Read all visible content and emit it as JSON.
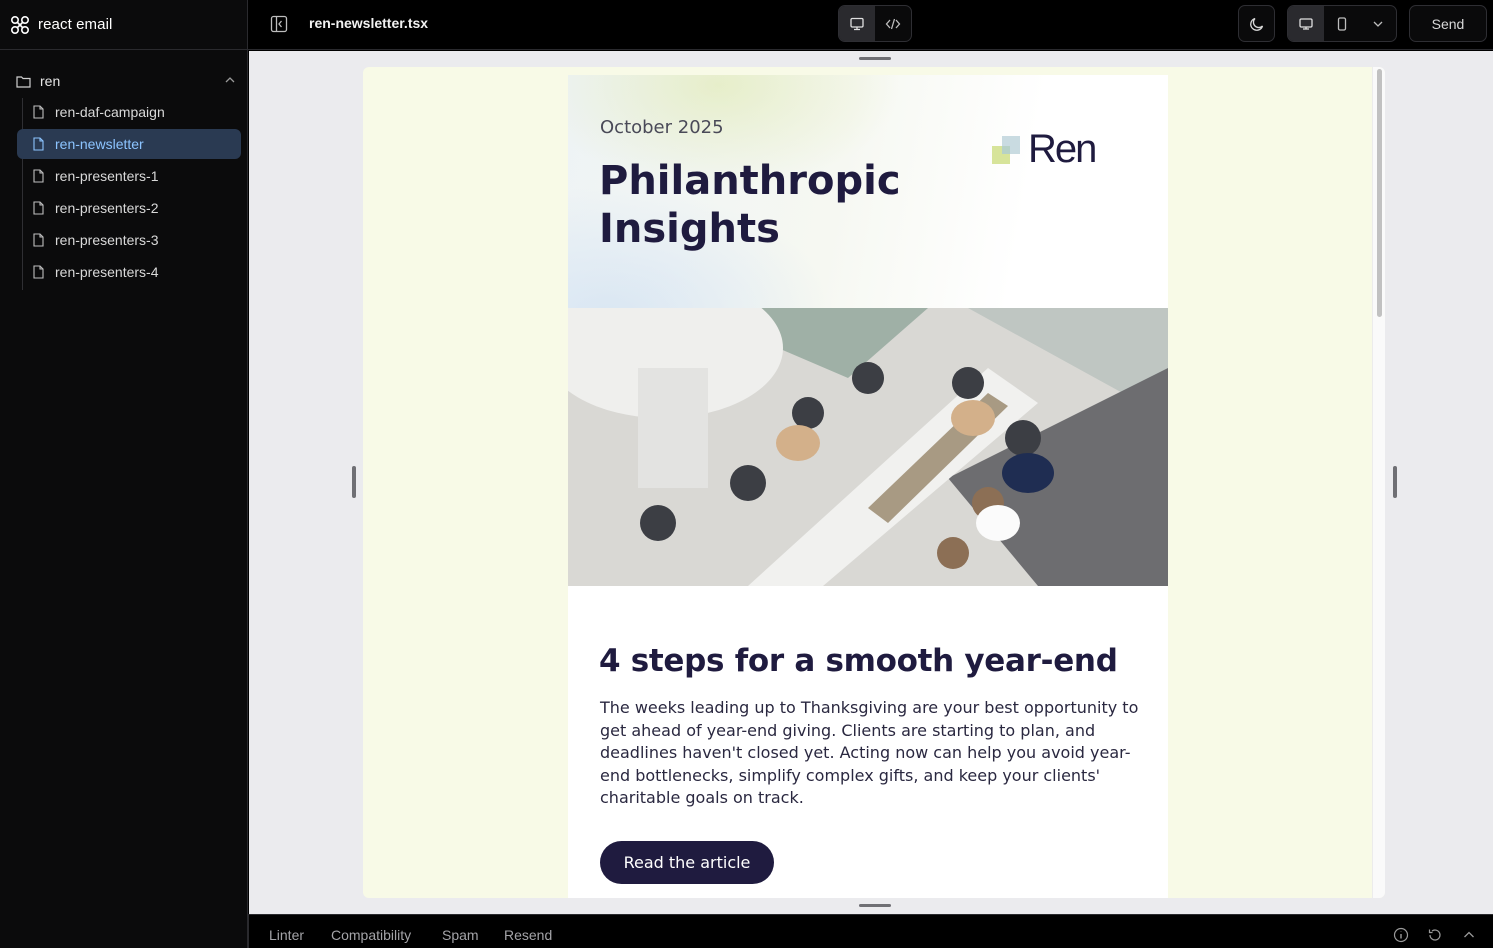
{
  "app": {
    "brand": "react email"
  },
  "sidebar": {
    "folder": "ren",
    "items": [
      {
        "label": "ren-daf-campaign"
      },
      {
        "label": "ren-newsletter",
        "active": true
      },
      {
        "label": "ren-presenters-1"
      },
      {
        "label": "ren-presenters-2"
      },
      {
        "label": "ren-presenters-3"
      },
      {
        "label": "ren-presenters-4"
      }
    ]
  },
  "topbar": {
    "filename": "ren-newsletter.tsx",
    "view_modes": [
      "desktop-icon",
      "code-icon"
    ],
    "active_view": "desktop",
    "device": "desktop",
    "send_label": "Send"
  },
  "email": {
    "date": "October 2025",
    "title": "Philanthropic Insights",
    "logo_text": "Ren",
    "heading": "4 steps for a smooth year-end",
    "body": "The weeks leading up to Thanksgiving are your best opportunity to get ahead of year-end giving. Clients are starting to plan, and deadlines haven't closed yet. Acting now can help you avoid year-end bottlenecks, simplify complex gifts, and keep your clients' charitable goals on track.",
    "cta_label": "Read the article",
    "colors": {
      "navy": "#1f1b3f",
      "frame_bg": "#f8fae7"
    }
  },
  "bottombar": {
    "tabs": [
      "Linter",
      "Compatibility",
      "Spam",
      "Resend"
    ]
  }
}
